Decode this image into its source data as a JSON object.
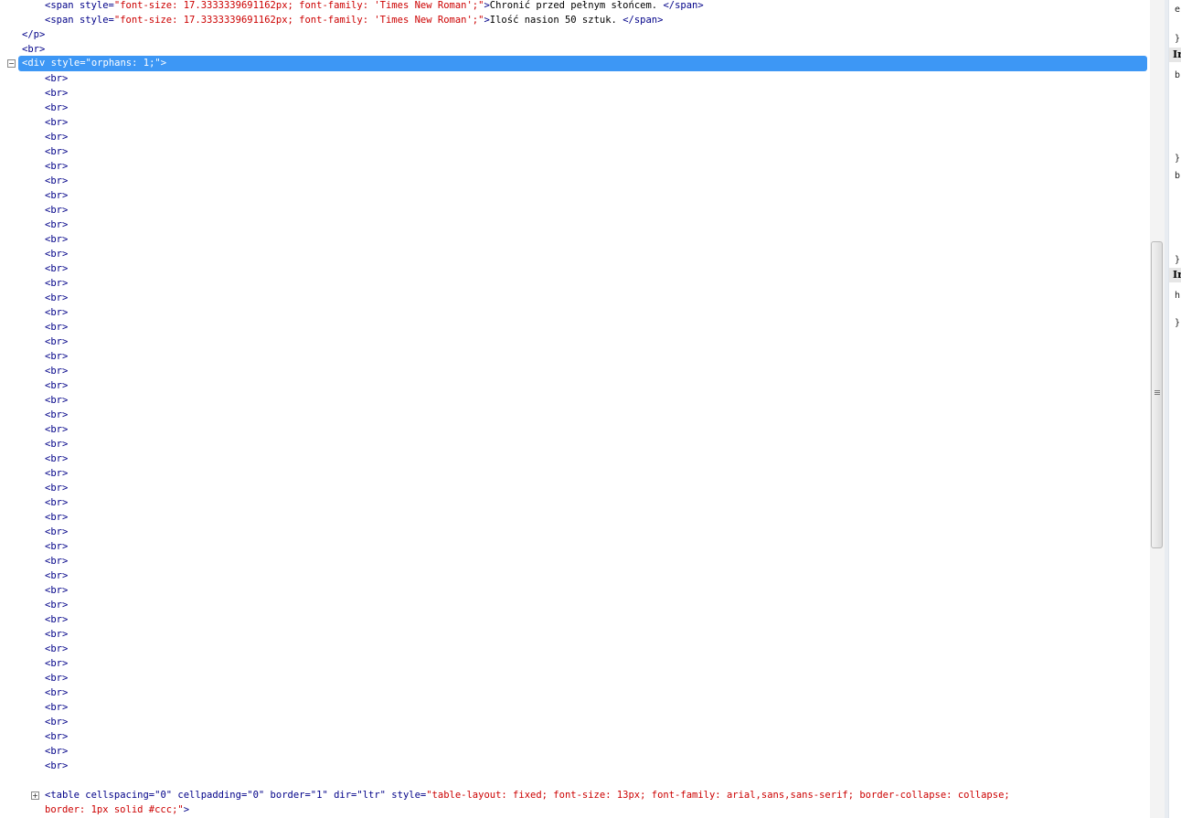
{
  "html_tree": {
    "lines_top": [
      {
        "indent": 2,
        "open_tag": "<span",
        "attr_name": "style=",
        "attr_value": "\"font-size: 17.3333339691162px; font-family: 'Times New Roman';\"",
        "close": ">",
        "text": "Chronić przed pełnym słońcem. ",
        "end_tag": "</span>"
      },
      {
        "indent": 2,
        "open_tag": "<span",
        "attr_name": "style=",
        "attr_value": "\"font-size: 17.3333339691162px; font-family: 'Times New Roman';\"",
        "close": ">",
        "text": "Ilość nasion 50 sztuk. ",
        "end_tag": "</span>"
      }
    ],
    "closing_p": "</p>",
    "br": "<br>",
    "selected_node": "<div style=\"orphans: 1;\">",
    "child_br": "<br>",
    "table_line1_tag": "<table",
    "table_line1_attrs": " cellspacing=\"0\" cellpadding=\"0\" border=\"1\" dir=\"ltr\" style=",
    "table_line1_value": "\"table-layout: fixed; font-size: 13px; font-family: arial,sans,sans-serif; border-collapse: collapse;",
    "table_line2_value": "border: 1px solid #ccc;\"",
    "table_line2_close": ">",
    "collapse_glyph": "−",
    "expand_glyph": "+"
  },
  "style_panel": {
    "lines": [
      "e",
      "}",
      "Ir",
      "b",
      "}",
      "b",
      "}",
      "Ir",
      "h",
      "}"
    ]
  },
  "colors": {
    "tag": "#000088",
    "attr_value": "#cc0000",
    "selection": "#3d97f5"
  }
}
